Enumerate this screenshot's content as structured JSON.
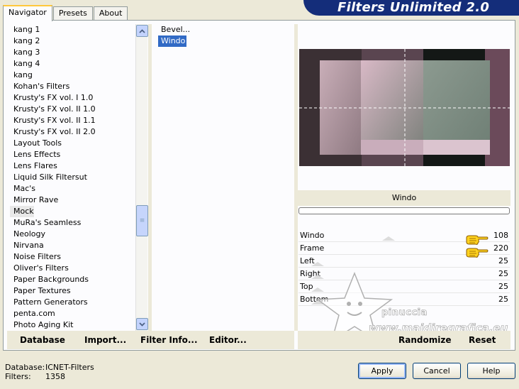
{
  "tabs": [
    {
      "label": "Navigator",
      "active": true
    },
    {
      "label": "Presets",
      "active": false
    },
    {
      "label": "About",
      "active": false
    }
  ],
  "banner": {
    "title": "Filters Unlimited 2.0"
  },
  "categories": {
    "items": [
      "kang 1",
      "kang 2",
      "kang 3",
      "kang 4",
      "kang",
      "Kohan's Filters",
      "Krusty's FX vol. I 1.0",
      "Krusty's FX vol. II 1.0",
      "Krusty's FX vol. II 1.1",
      "Krusty's FX vol. II 2.0",
      "Layout Tools",
      "Lens Effects",
      "Lens Flares",
      "Liquid Silk Filtersut",
      "Mac's",
      "Mirror Rave",
      "Mock",
      "MuRa's Seamless",
      "Neology",
      "Nirvana",
      "Noise Filters",
      "Oliver's Filters",
      "Paper Backgrounds",
      "Paper Textures",
      "Pattern Generators",
      "penta.com",
      "Photo Aging Kit"
    ],
    "selected": "Mock"
  },
  "filters": {
    "items": [
      "Bevel...",
      "Windo"
    ],
    "selected": "Windo"
  },
  "preview": {
    "filter_name": "Windo"
  },
  "params": [
    {
      "name": "Windo",
      "value": "108"
    },
    {
      "name": "Frame",
      "value": "220"
    },
    {
      "name": "Left",
      "value": "25"
    },
    {
      "name": "Right",
      "value": "25"
    },
    {
      "name": "Top",
      "value": "25"
    },
    {
      "name": "Bottom",
      "value": "25"
    }
  ],
  "toolbar": {
    "database_label": "Database",
    "import_label": "Import...",
    "filter_info_label": "Filter Info...",
    "editor_label": "Editor...",
    "randomize_label": "Randomize",
    "reset_label": "Reset"
  },
  "status": {
    "database_label": "Database:",
    "database_value": "ICNET-Filters",
    "filters_label": "Filters:",
    "filters_value": "1358"
  },
  "dialog": {
    "apply_label": "Apply",
    "cancel_label": "Cancel",
    "help_label": "Help"
  },
  "watermark": {
    "line1": "pinuccia",
    "line2": "www.maidiregrafica.eu"
  },
  "icons": {
    "scroll_up": "chevron-up-icon",
    "scroll_down": "chevron-down-icon",
    "pointer": "pointing-hand-icon"
  },
  "colors": {
    "banner": "#142d7a",
    "selection": "#316ac5",
    "tab_highlight": "#ffc83c",
    "window_bg": "#ece9d8"
  }
}
